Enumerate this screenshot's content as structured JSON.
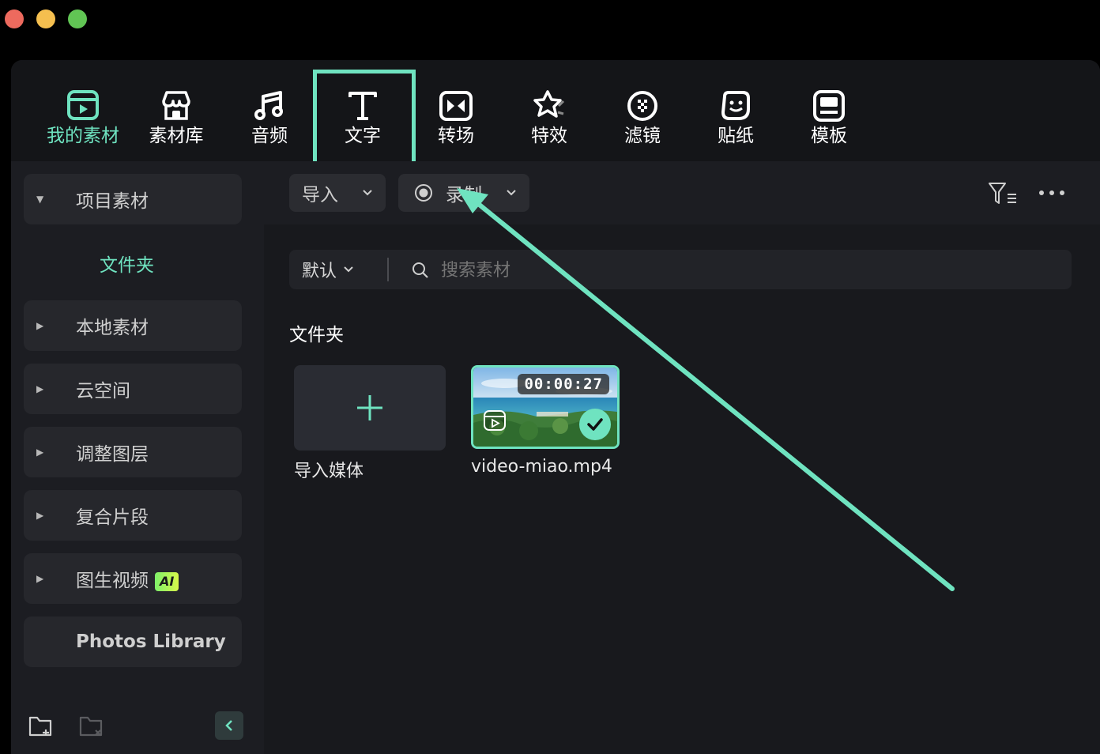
{
  "window": {
    "traffic_lights": {
      "close_color": "#ed6a5e",
      "minimize_color": "#f5bf4f",
      "maximize_color": "#61c554"
    }
  },
  "nav": {
    "accent_color": "#6fe3c0",
    "items": [
      {
        "label": "我的素材",
        "icon": "media-icon",
        "active": true
      },
      {
        "label": "素材库",
        "icon": "store-icon",
        "active": false
      },
      {
        "label": "音频",
        "icon": "music-note-icon",
        "active": false
      },
      {
        "label": "文字",
        "icon": "text-t-icon",
        "active": false,
        "highlighted": true
      },
      {
        "label": "转场",
        "icon": "transition-icon",
        "active": false
      },
      {
        "label": "特效",
        "icon": "effects-star-icon",
        "active": false
      },
      {
        "label": "滤镜",
        "icon": "filter-icon",
        "active": false
      },
      {
        "label": "贴纸",
        "icon": "sticker-icon",
        "active": false
      },
      {
        "label": "模板",
        "icon": "template-icon",
        "active": false
      }
    ]
  },
  "sidebar": {
    "project_media": "项目素材",
    "folder": "文件夹",
    "items": [
      {
        "label": "本地素材"
      },
      {
        "label": "云空间"
      },
      {
        "label": "调整图层"
      },
      {
        "label": "复合片段"
      },
      {
        "label": "图生视频",
        "badge": "AI"
      }
    ],
    "photos_library": "Photos Library"
  },
  "toolbar": {
    "import_label": "导入",
    "record_label": "录制"
  },
  "search": {
    "sort_label": "默认",
    "placeholder": "搜索素材"
  },
  "content": {
    "section_title": "文件夹",
    "import_tile_label": "导入媒体",
    "clips": [
      {
        "filename": "video-miao.mp4",
        "duration": "00:00:27",
        "selected": true
      }
    ]
  }
}
